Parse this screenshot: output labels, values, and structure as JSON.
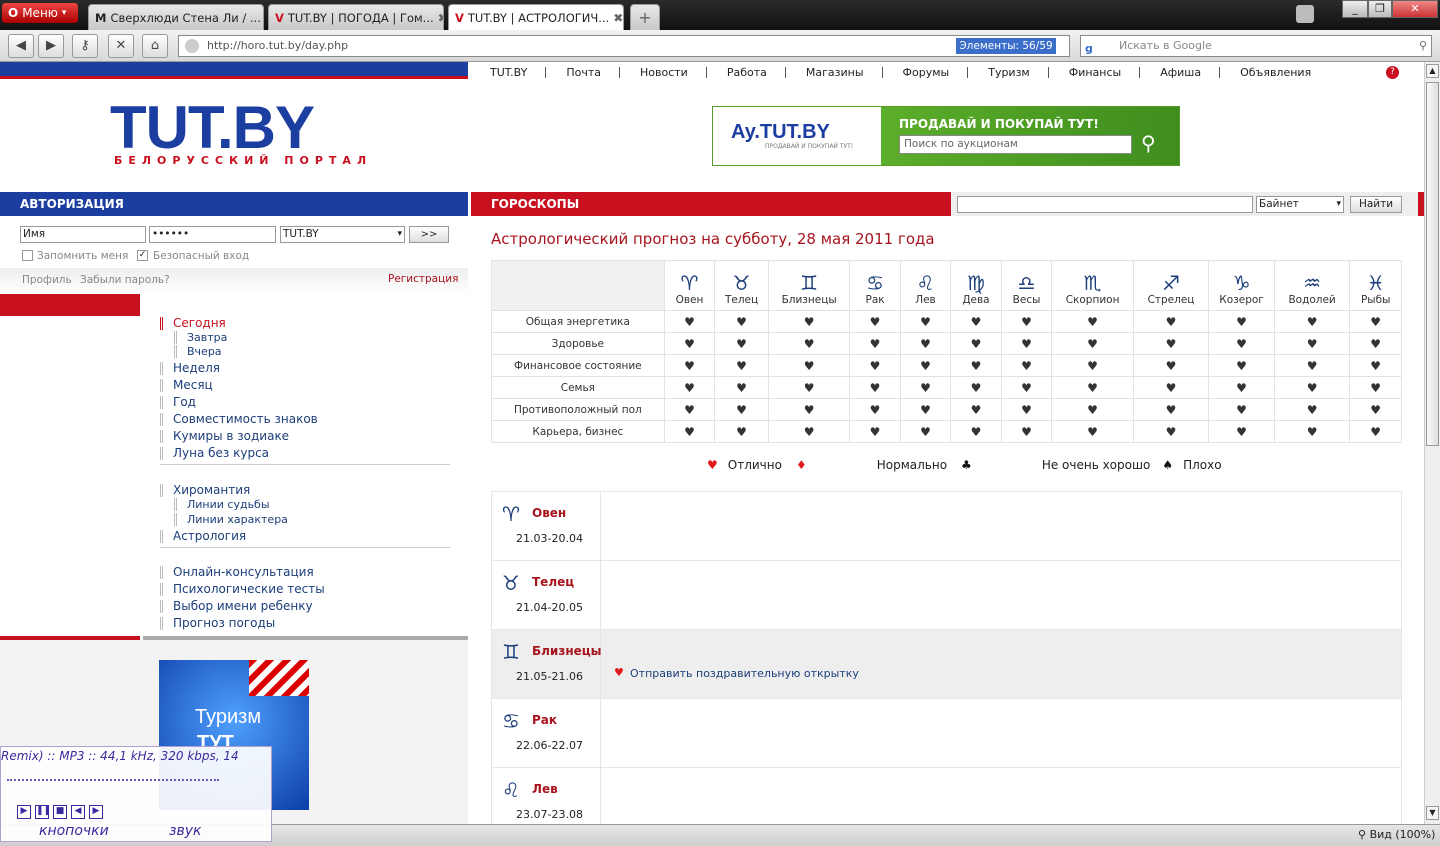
{
  "browser": {
    "menu_label": "Меню",
    "tabs": [
      {
        "icon": "M",
        "label": "Сверхлюди Стена Ли / ..."
      },
      {
        "icon": "V",
        "label": "TUT.BY | ПОГОДА | Гом..."
      },
      {
        "icon": "V",
        "label": "TUT.BY | АСТРОЛОГИЧ..."
      }
    ],
    "address": "http://horo.tut.by/day.php",
    "elements_label": "Элементы:  56/59",
    "search_placeholder": "Искать в Google",
    "zoom_label": "Вид (100%)"
  },
  "topnav": [
    "TUT.BY",
    "Почта",
    "Новости",
    "Работа",
    "Магазины",
    "Форумы",
    "Туризм",
    "Финансы",
    "Афиша",
    "Объявления"
  ],
  "logo": {
    "title": "TUT.BY",
    "subtitle": "БЕЛОРУССКИЙ ПОРТАЛ"
  },
  "banner": {
    "logo": "Ay.TUT.BY",
    "tagline": "ПРОДАВАЙ И ПОКУПАЙ ТУТ!",
    "heading": "ПРОДАВАЙ И ПОКУПАЙ ТУТ!",
    "placeholder": "Поиск по аукционам"
  },
  "auth": {
    "header": "АВТОРИЗАЦИЯ",
    "name_value": "Имя",
    "password_value": "••••••",
    "domain_value": "TUT.BY",
    "go_label": ">>",
    "remember_label": "Запомнить меня",
    "secure_label": "Безопасный вход",
    "profile_link": "Профиль",
    "forgot_link": "Забыли пароль?",
    "register_link": "Регистрация"
  },
  "menu": {
    "group1": [
      {
        "label": "Сегодня",
        "active": true
      },
      {
        "label": "Завтра",
        "sub": true
      },
      {
        "label": "Вчера",
        "sub": true
      },
      {
        "label": "Неделя"
      },
      {
        "label": "Месяц"
      },
      {
        "label": "Год"
      },
      {
        "label": "Совместимость знаков"
      },
      {
        "label": "Кумиры в зодиаке"
      },
      {
        "label": "Луна без курса"
      }
    ],
    "group2": [
      {
        "label": "Хиромантия"
      },
      {
        "label": "Линии судьбы",
        "sub": true
      },
      {
        "label": "Линии характера",
        "sub": true
      },
      {
        "label": "Астрология"
      }
    ],
    "group3": [
      {
        "label": "Онлайн-консультация"
      },
      {
        "label": "Психологичеcкие тесты"
      },
      {
        "label": "Выбор имени ребенку"
      },
      {
        "label": "Прогноз погоды"
      }
    ]
  },
  "ad": {
    "text": "Туризм",
    "sub": "ТУТ"
  },
  "overlay": {
    "track": "Remix) :: MP3 :: 44,1 kHz, 320 kbps, 14",
    "buttons_label": "кнопочки",
    "sound_label": "звук"
  },
  "horo": {
    "header": "ГОРОСКОПЫ",
    "search_select": "Байнет",
    "search_button": "Найти",
    "title": "Астрологический прогноз на субботу, 28 мая 2011 года",
    "signs": [
      {
        "symbol": "♈",
        "name": "Овен"
      },
      {
        "symbol": "♉",
        "name": "Телец"
      },
      {
        "symbol": "♊",
        "name": "Близнецы"
      },
      {
        "symbol": "♋",
        "name": "Рак"
      },
      {
        "symbol": "♌",
        "name": "Лев"
      },
      {
        "symbol": "♍",
        "name": "Дева"
      },
      {
        "symbol": "♎",
        "name": "Весы"
      },
      {
        "symbol": "♏",
        "name": "Скорпион"
      },
      {
        "symbol": "♐",
        "name": "Стрелец"
      },
      {
        "symbol": "♑",
        "name": "Козерог"
      },
      {
        "symbol": "♒",
        "name": "Водолей"
      },
      {
        "symbol": "♓",
        "name": "Рыбы"
      }
    ],
    "rows": [
      "Общая энергетика",
      "Здоровье",
      "Финансовое состояние",
      "Семья",
      "Противоположный пол",
      "Карьера, бизнес"
    ],
    "ratings": [
      [
        "♥",
        "♥",
        "♥",
        "♥",
        "♥",
        "♥",
        "♥",
        "♥",
        "♥",
        "♥",
        "♥",
        "♥"
      ],
      [
        "♥",
        "♥",
        "♥",
        "♥",
        "♥",
        "♥",
        "♥",
        "♥",
        "♥",
        "♥",
        "♥",
        "♥"
      ],
      [
        "♥",
        "♥",
        "♥",
        "♥",
        "♥",
        "♥",
        "♥",
        "♥",
        "♥",
        "♥",
        "♥",
        "♥"
      ],
      [
        "♥",
        "♥",
        "♥",
        "♥",
        "♥",
        "♥",
        "♥",
        "♥",
        "♥",
        "♥",
        "♥",
        "♥"
      ],
      [
        "♥",
        "♥",
        "♥",
        "♥",
        "♥",
        "♥",
        "♥",
        "♥",
        "♥",
        "♥",
        "♥",
        "♥"
      ],
      [
        "♥",
        "♥",
        "♥",
        "♥",
        "♥",
        "♥",
        "♥",
        "♥",
        "♥",
        "♥",
        "♥",
        "♥"
      ]
    ],
    "legend": [
      {
        "icon": "♥",
        "label": "Отлично"
      },
      {
        "icon": "♦",
        "label": "Нормально"
      },
      {
        "icon": "♣",
        "label": "Не очень хорошо"
      },
      {
        "icon": "♠",
        "label": "Плохо"
      }
    ],
    "forecasts": [
      {
        "symbol": "♈",
        "name": "Овен",
        "dates": "21.03-20.04"
      },
      {
        "symbol": "♉",
        "name": "Телец",
        "dates": "21.04-20.05"
      },
      {
        "symbol": "♊",
        "name": "Близнецы",
        "dates": "21.05-21.06",
        "highlight": true,
        "link": "Отправить поздравительную открытку"
      },
      {
        "symbol": "♋",
        "name": "Рак",
        "dates": "22.06-22.07"
      },
      {
        "symbol": "♌",
        "name": "Лев",
        "dates": "23.07-23.08"
      }
    ]
  },
  "colors": {
    "brand_blue": "#1c3ea0",
    "brand_red": "#c8101e",
    "heart": "#e21c1c"
  }
}
